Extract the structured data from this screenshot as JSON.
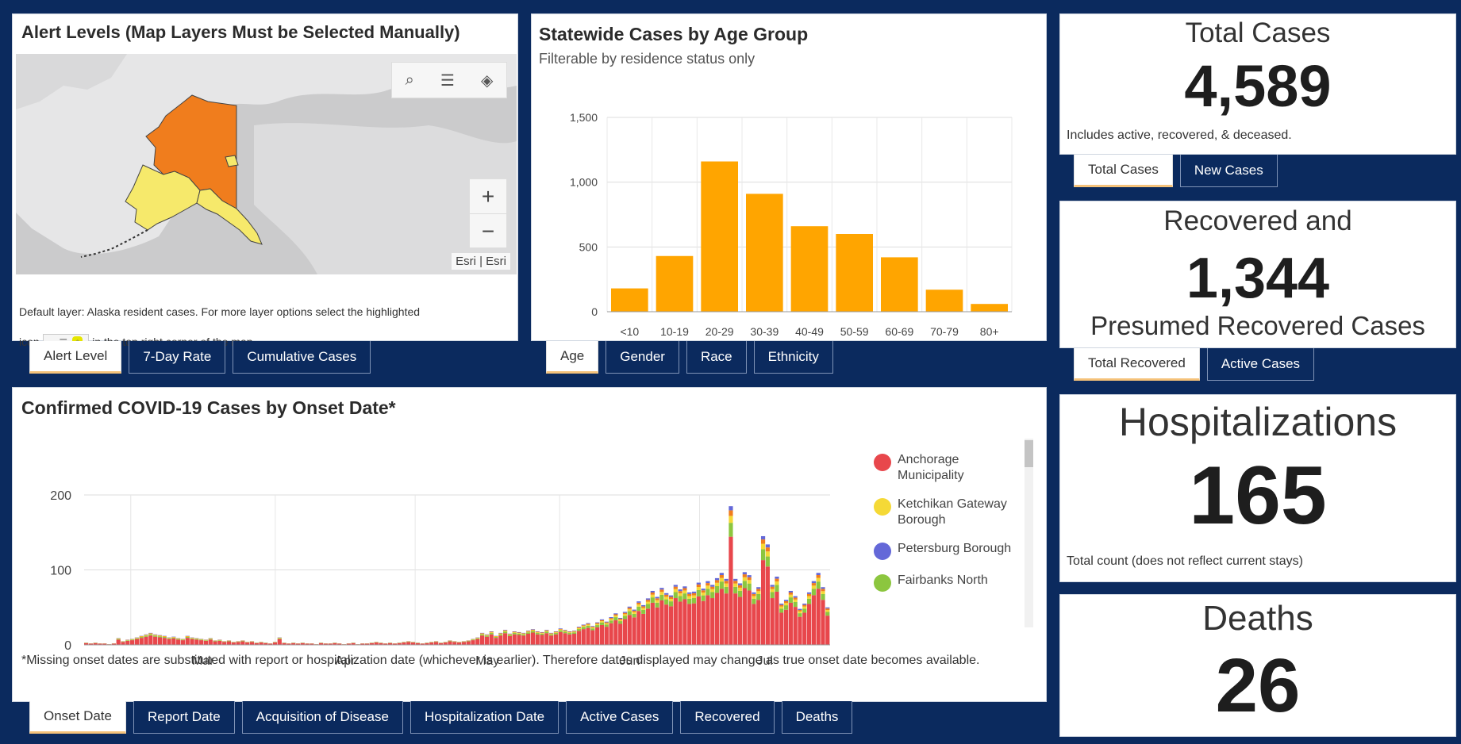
{
  "alert_panel": {
    "title": "Alert Levels (Map Layers Must be Selected Manually)",
    "map_attribution": "Esri | Esri",
    "note_part1": "Default layer: Alaska resident cases. For more layer options select the highlighted",
    "note_icon_word": "icon",
    "note_part2": "in the top right corner of the map.",
    "tabs": [
      "Alert Level",
      "7-Day Rate",
      "Cumulative Cases"
    ],
    "colors": {
      "orange": "#f07d1d",
      "yellow": "#f6e96b"
    }
  },
  "age_panel": {
    "title": "Statewide Cases by Age Group",
    "subtitle": "Filterable by residence status only",
    "tabs": [
      "Age",
      "Gender",
      "Race",
      "Ethnicity"
    ]
  },
  "total_cases": {
    "title": "Total Cases",
    "value": "4,589",
    "note": "Includes active, recovered, & deceased.",
    "tabs": [
      "Total Cases",
      "New Cases"
    ]
  },
  "recovered": {
    "title_line1": "Recovered and",
    "value": "1,344",
    "title_line2": "Presumed Recovered Cases",
    "tabs": [
      "Total Recovered",
      "Active Cases"
    ]
  },
  "hospitalizations": {
    "title": "Hospitalizations",
    "value": "165",
    "note": "Total count (does not reflect current stays)"
  },
  "deaths": {
    "title": "Deaths",
    "value": "26"
  },
  "onset_panel": {
    "title": "Confirmed COVID-19 Cases by Onset Date*",
    "footnote": "*Missing onset dates are substituted with report or hospitalization date (whichever is earlier). Therefore dates displayed may change as true onset date becomes available.",
    "legend": [
      {
        "name": "Anchorage Municipality",
        "color": "#e8474c"
      },
      {
        "name": "Ketchikan Gateway Borough",
        "color": "#f5d936"
      },
      {
        "name": "Petersburg Borough",
        "color": "#6468d8"
      },
      {
        "name": "Fairbanks North",
        "color": "#8cc63f"
      }
    ],
    "tabs": [
      "Onset Date",
      "Report Date",
      "Acquisition of Disease",
      "Hospitalization Date",
      "Active Cases",
      "Recovered",
      "Deaths"
    ]
  },
  "chart_data": [
    {
      "type": "bar",
      "title": "Statewide Cases by Age Group",
      "categories": [
        "<10",
        "10-19",
        "20-29",
        "30-39",
        "40-49",
        "50-59",
        "60-69",
        "70-79",
        "80+"
      ],
      "values": [
        180,
        430,
        1160,
        910,
        660,
        600,
        420,
        170,
        60
      ],
      "ylim": [
        0,
        1500
      ],
      "yticks": [
        "0",
        "500",
        "1,000",
        "1,500"
      ],
      "color": "#ffa500",
      "grid": true
    },
    {
      "type": "bar",
      "title": "Confirmed COVID-19 Cases by Onset Date*",
      "x_start": "2020-02-20",
      "x_end": "2020-07-29",
      "xticks": [
        "Mar",
        "Apr",
        "May",
        "Jun",
        "Jul"
      ],
      "ylim": [
        0,
        200
      ],
      "yticks": [
        "0",
        "100",
        "200"
      ],
      "stacked": true,
      "grid": true,
      "values": [
        3,
        2,
        3,
        2,
        2,
        1,
        2,
        9,
        5,
        7,
        8,
        10,
        12,
        14,
        16,
        14,
        13,
        12,
        10,
        11,
        9,
        8,
        12,
        10,
        9,
        8,
        7,
        9,
        6,
        7,
        5,
        6,
        4,
        5,
        6,
        4,
        5,
        3,
        4,
        3,
        2,
        4,
        10,
        3,
        2,
        3,
        2,
        3,
        2,
        2,
        1,
        3,
        2,
        2,
        3,
        2,
        1,
        2,
        3,
        1,
        2,
        2,
        3,
        4,
        3,
        2,
        3,
        2,
        3,
        4,
        5,
        4,
        3,
        2,
        3,
        4,
        5,
        3,
        4,
        6,
        5,
        4,
        5,
        6,
        8,
        10,
        16,
        14,
        18,
        12,
        16,
        20,
        15,
        18,
        17,
        16,
        19,
        21,
        18,
        17,
        20,
        16,
        18,
        22,
        20,
        18,
        19,
        24,
        27,
        29,
        25,
        30,
        34,
        31,
        37,
        42,
        36,
        44,
        51,
        47,
        58,
        53,
        62,
        72,
        64,
        76,
        69,
        66,
        80,
        74,
        78,
        70,
        71,
        83,
        75,
        85,
        80,
        89,
        96,
        88,
        185,
        88,
        82,
        97,
        93,
        70,
        77,
        145,
        134,
        80,
        91,
        55,
        60,
        72,
        65,
        48,
        55,
        70,
        85,
        96,
        77,
        50
      ]
    }
  ]
}
